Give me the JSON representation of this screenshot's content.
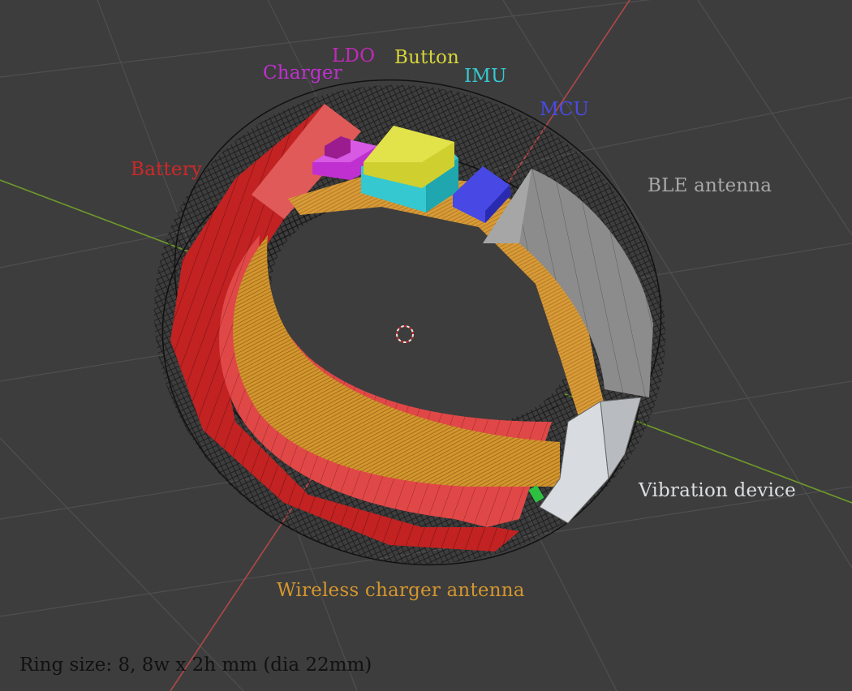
{
  "labels": {
    "ldo": "LDO",
    "charger": "Charger",
    "button": "Button",
    "imu": "IMU",
    "mcu": "MCU",
    "battery": "Battery",
    "ble_antenna": "BLE antenna",
    "vibration_device": "Vibration device",
    "wireless_charger_antenna": "Wireless charger antenna"
  },
  "caption": "Ring size: 8, 8w x 2h mm (dia 22mm)",
  "colors": {
    "background": "#3d3d3d",
    "grid": "#4f4f4f",
    "axis_x": "#6f9a2a",
    "axis_y": "#b04848",
    "battery": "#d42a2a",
    "charger": "#c030d0",
    "ldo": "#b82aa8",
    "button": "#d9d83a",
    "imu": "#35c8d0",
    "mcu": "#4040e0",
    "ble_antenna": "#8a8a8a",
    "vibration_device": "#d8dce0",
    "wireless_charger_antenna": "#d4962e"
  }
}
